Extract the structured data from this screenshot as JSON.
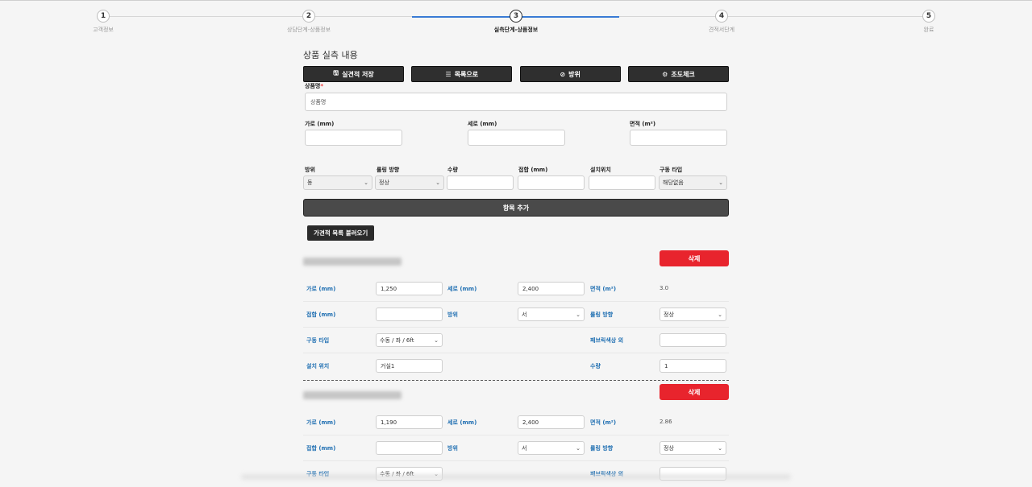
{
  "stepper": {
    "steps": [
      {
        "num": "1",
        "label": "고객정보"
      },
      {
        "num": "2",
        "label": "상담단계-상품정보"
      },
      {
        "num": "3",
        "label": "실측단계-상품정보"
      },
      {
        "num": "4",
        "label": "견적서단계"
      },
      {
        "num": "5",
        "label": "완료"
      }
    ],
    "active_step": 3
  },
  "section_title": "상품 실측 내용",
  "toolbar": {
    "save_label": "실견적 저장",
    "list_label": "목록으로",
    "direction_label": "방위",
    "light_label": "조도체크"
  },
  "form": {
    "product_name_label": "상품명",
    "product_name_required": "*",
    "product_name_placeholder": "상품명",
    "width_label": "가로 (mm)",
    "height_label": "세로 (mm)",
    "area_label": "면적 (m²)",
    "direction_label": "방위",
    "direction_value": "동",
    "rolling_label": "롤링 방향",
    "rolling_value": "정상",
    "quantity_label": "수량",
    "overlap_label": "접합 (mm)",
    "location_label": "설치위치",
    "drive_label": "구동 타입",
    "drive_value": "해당없음",
    "add_item_label": "항목 추가",
    "load_estimate_label": "가견적 목록 불러오기"
  },
  "items": [
    {
      "delete_label": "삭제",
      "width_label": "가로 (mm)",
      "width_value": "1,250",
      "height_label": "세로 (mm)",
      "height_value": "2,400",
      "area_label": "면적 (m²)",
      "area_value": "3.0",
      "overlap_label": "접합 (mm)",
      "overlap_value": "",
      "direction_label": "방위",
      "direction_value": "서",
      "rolling_label": "롤링 방향",
      "rolling_value": "정상",
      "drive_label": "구동 타입",
      "drive_value": "수동 / 좌 / 6ft",
      "fabric_label": "패브릭색상 외",
      "fabric_value": "",
      "location_label": "설치 위치",
      "location_value": "거실1",
      "quantity_label": "수량",
      "quantity_value": "1"
    },
    {
      "delete_label": "삭제",
      "width_label": "가로 (mm)",
      "width_value": "1,190",
      "height_label": "세로 (mm)",
      "height_value": "2,400",
      "area_label": "면적 (m²)",
      "area_value": "2.86",
      "overlap_label": "접합 (mm)",
      "overlap_value": "",
      "direction_label": "방위",
      "direction_value": "서",
      "rolling_label": "롤링 방향",
      "rolling_value": "정상",
      "drive_label": "구동 타입",
      "drive_value": "수동 / 좌 / 6ft",
      "fabric_label": "패브릭색상 외",
      "fabric_value": ""
    }
  ],
  "colors": {
    "accent_blue": "#3a7bd5",
    "label_blue": "#1f6fb2",
    "delete_red": "#e8242d",
    "button_dark": "#2f2f2f"
  }
}
